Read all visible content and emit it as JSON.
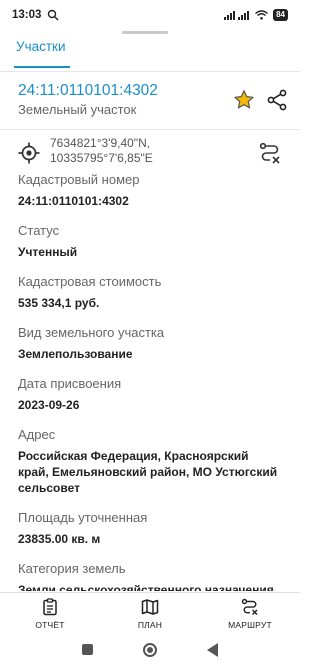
{
  "status_bar": {
    "time": "13:03",
    "battery": "84"
  },
  "tabs": [
    {
      "label": "Участки"
    }
  ],
  "parcel": {
    "number": "24:11:0110101:4302",
    "type": "Земельный участок",
    "coordinates": {
      "lat": "7634821°3'9,40\"N,",
      "lon": "10335795°7'6,85\"E"
    }
  },
  "fields": [
    {
      "label": "Кадастровый номер",
      "value": "24:11:0110101:4302"
    },
    {
      "label": "Статус",
      "value": "Учтенный"
    },
    {
      "label": "Кадастровая стоимость",
      "value": "535 334,1 руб."
    },
    {
      "label": "Вид земельного участка",
      "value": "Землепользование"
    },
    {
      "label": "Дата присвоения",
      "value": "2023-09-26"
    },
    {
      "label": "Адрес",
      "value": "Российская Федерация, Красноярский край, Емельяновский район, МО Устюгский сельсовет"
    },
    {
      "label": "Площадь уточненная",
      "value": "23835.00 кв. м"
    },
    {
      "label": "Категория земель",
      "value": "Земли сельскохозяйственного назначения"
    }
  ],
  "bottom_nav": [
    {
      "label": "ОТЧЁТ",
      "icon": "clipboard-icon"
    },
    {
      "label": "ПЛАН",
      "icon": "map-icon"
    },
    {
      "label": "МАРШРУТ",
      "icon": "route-icon"
    }
  ],
  "colors": {
    "accent": "#1a8fc9",
    "star": "#f2b705"
  }
}
